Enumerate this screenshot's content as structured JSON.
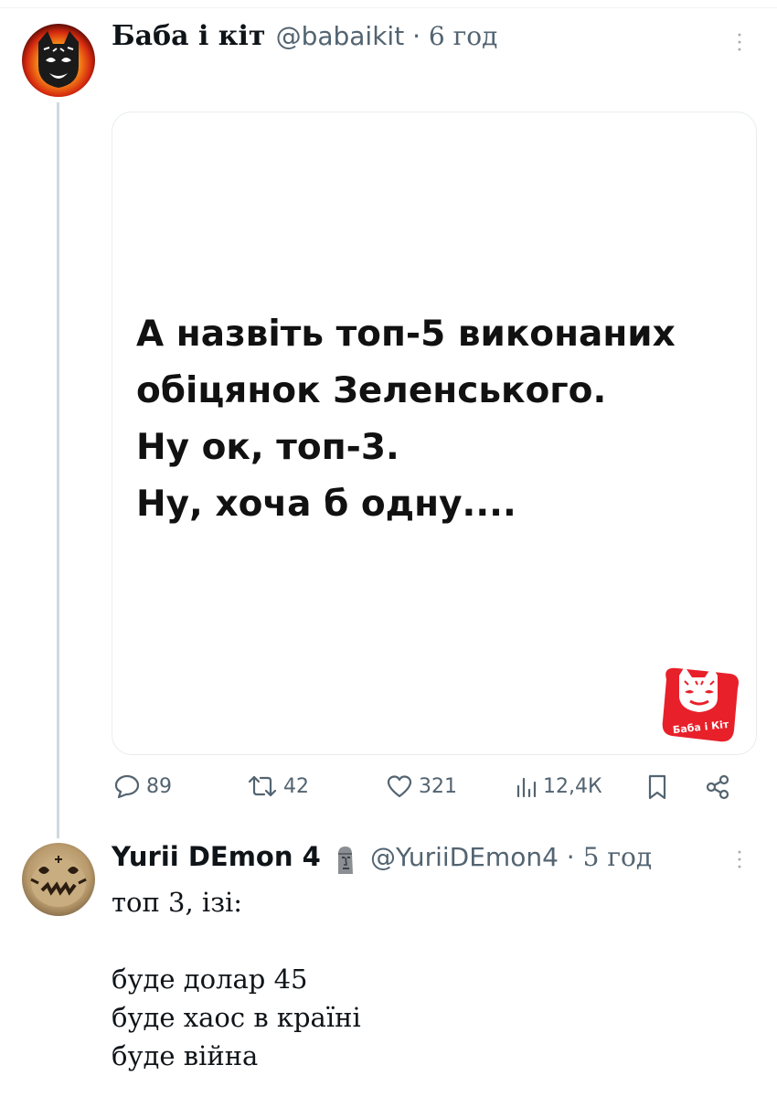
{
  "post": {
    "author_name": "Баба і кіт",
    "author_handle": "@babaikit",
    "separator": "·",
    "time": "6 год",
    "card_lines": [
      "А назвіть топ-5 виконаних",
      "обіцянок Зеленського.",
      "Ну ок, топ-3.",
      "Ну, хоча б одну...."
    ],
    "logo_text": "Баба і Кіт",
    "logo_color": "#e8202a",
    "stats": {
      "replies": "89",
      "reposts": "42",
      "likes": "321",
      "views": "12,4К"
    }
  },
  "reply": {
    "author_name": "Yurii DEmon 4",
    "badge_icon": "moai-icon",
    "author_handle": "@YuriiDEmon4",
    "separator": "·",
    "time": "5 год",
    "text_lines": [
      "топ 3, ізі:",
      "",
      "буде долар 45",
      "буде хаос в країні",
      "буде війна"
    ]
  },
  "colors": {
    "text": "#0f1419",
    "secondary": "#536471",
    "thread_line": "#cfd9de"
  }
}
